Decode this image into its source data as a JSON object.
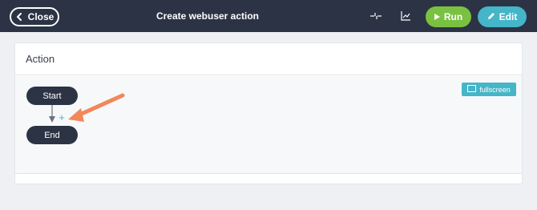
{
  "header": {
    "close_label": "Close",
    "title": "Create webuser action",
    "run_label": "Run",
    "edit_label": "Edit"
  },
  "icons": {
    "close": "chevron-left-icon",
    "compress": "compress-icon",
    "chart": "line-chart-icon",
    "run": "play-icon",
    "edit": "pencil-icon",
    "fullscreen": "expand-icon",
    "add": "plus-icon",
    "annotation": "arrow-annotation"
  },
  "card": {
    "title": "Action",
    "fullscreen_label": "fullscreen"
  },
  "flow": {
    "start_label": "Start",
    "end_label": "End",
    "add_symbol": "+"
  },
  "colors": {
    "topbar": "#2c3344",
    "run": "#7ac142",
    "edit": "#45b5c8",
    "node": "#2c3344",
    "annotation": "#f2875a"
  }
}
